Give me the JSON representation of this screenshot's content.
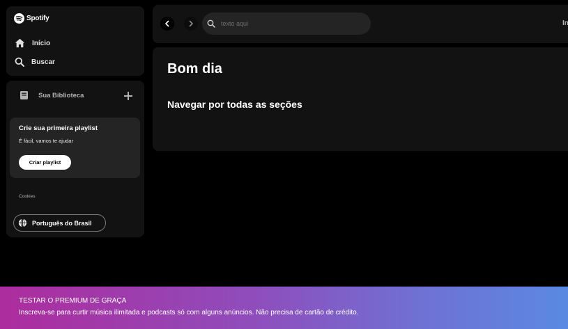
{
  "brand": {
    "name": "Spotify",
    "icon": "spotify-logo-icon",
    "accent": "#1db954"
  },
  "nav": {
    "items": [
      {
        "label": "Início",
        "icon": "home-icon"
      },
      {
        "label": "Buscar",
        "icon": "search-icon"
      }
    ]
  },
  "library": {
    "title": "Sua Biblioteca",
    "icon": "library-icon",
    "add_icon": "plus-icon",
    "card": {
      "title": "Crie sua primeira playlist",
      "subtitle": "É fácil, vamos te ajudar",
      "button_label": "Criar playlist"
    },
    "cookies_label": "Cookies",
    "language_label": "Português do Brasil",
    "language_icon": "globe-icon"
  },
  "topbar": {
    "back_icon": "chevron-left-icon",
    "forward_icon": "chevron-right-icon",
    "search_placeholder": "texto aqui",
    "search_value": "",
    "right_truncated_label": "In"
  },
  "main": {
    "greeting": "Bom dia",
    "section_title": "Navegar por todas as seções"
  },
  "banner": {
    "title": "TESTAR O PREMIUM DE GRAÇA",
    "subtitle": "Inscreva-se para curtir música ilimitada e podcasts só com alguns anúncios. Não precisa de cartão de crédito.",
    "gradient_start": "#ad2c9d",
    "gradient_end": "#5a89e2"
  }
}
